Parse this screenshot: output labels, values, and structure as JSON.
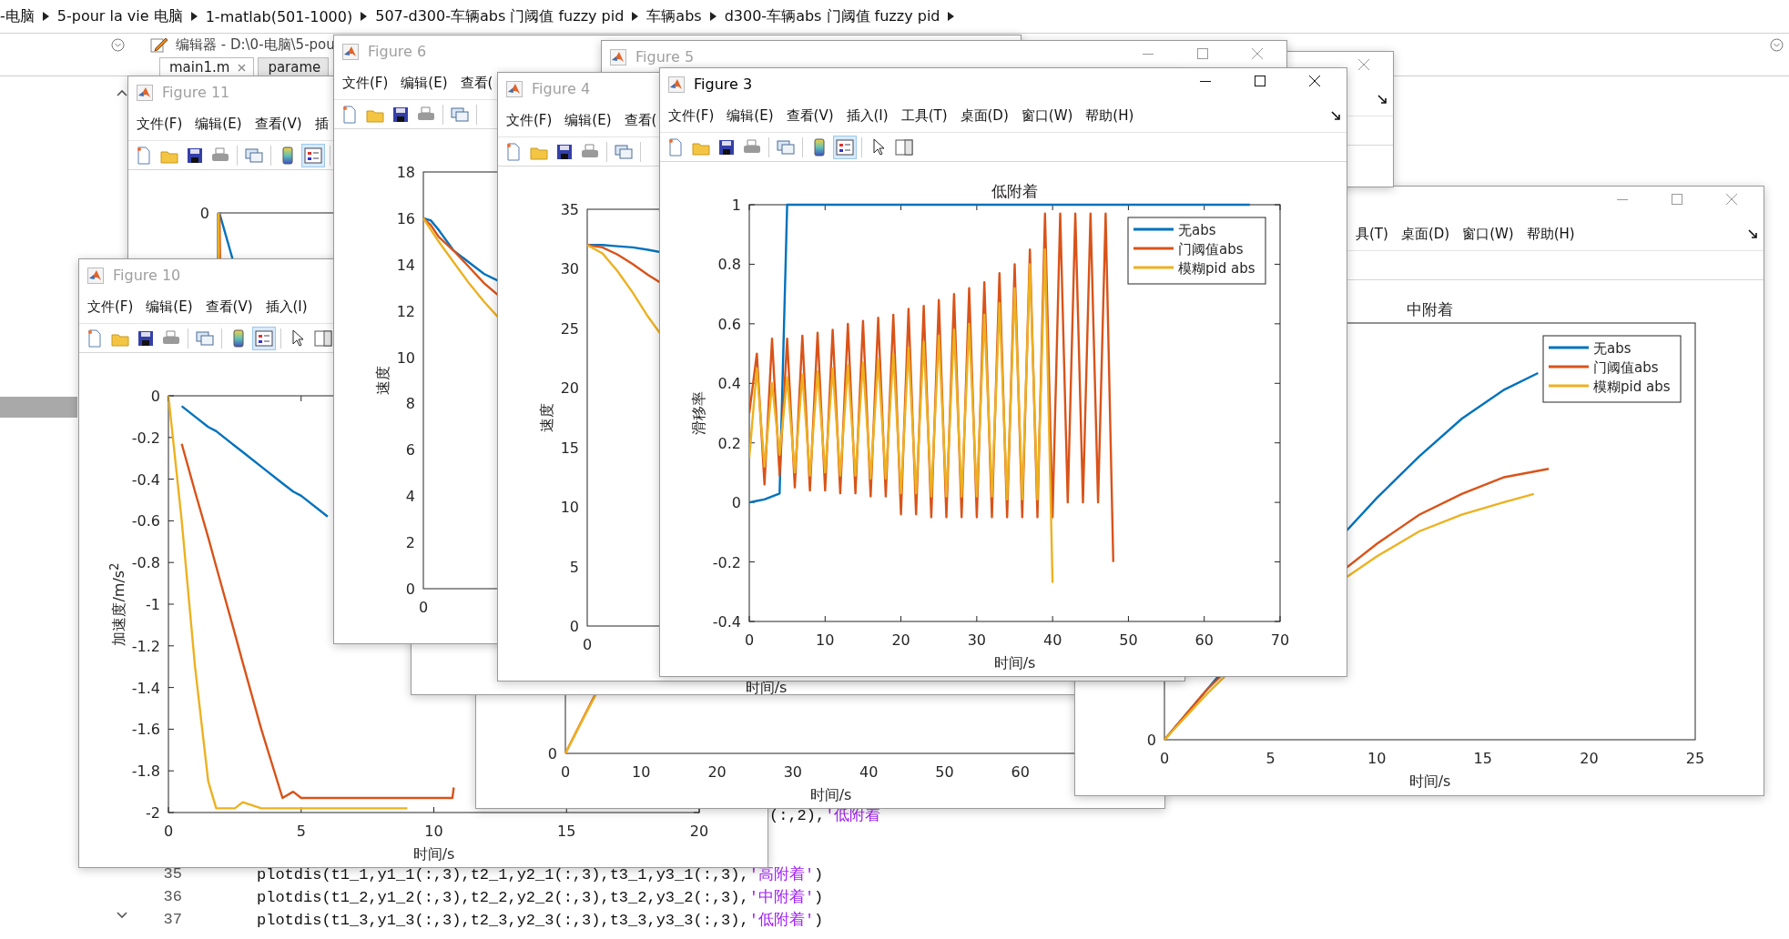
{
  "breadcrumb": [
    "-电脑",
    "5-pour la vie 电脑",
    "1-matlab(501-1000)",
    "507-d300-车辆abs 门阈值 fuzzy pid",
    "车辆abs",
    "d300-车辆abs 门阈值 fuzzy pid"
  ],
  "editor": {
    "title": "编辑器 - D:\\0-电脑\\5-pou",
    "tabs": [
      {
        "label": "main1.m",
        "selected": true
      },
      {
        "label": "parame",
        "selected": false
      }
    ],
    "fragment": {
      "code": "(:,2),",
      "string": "'低附着"
    },
    "lines": [
      {
        "number": "35",
        "code": "plotdis(t1_1,y1_1(:,3),t2_1,y2_1(:,3),t3_1,y3_1(:,3),",
        "string": "'高附着'",
        "tail": ")"
      },
      {
        "number": "36",
        "code": "plotdis(t1_2,y1_2(:,3),t2_2,y2_2(:,3),t3_2,y3_2(:,3),",
        "string": "'中附着'",
        "tail": ")"
      },
      {
        "number": "37",
        "code": "plotdis(t1_3,y1_3(:,3),t2_3,y2_3(:,3),t3_3,y3_3(:,3),",
        "string": "'低附着'",
        "tail": ")"
      }
    ]
  },
  "windows": [
    {
      "title": "Figure 11",
      "active": false,
      "menu": [
        "文件(F)",
        "编辑(E)",
        "查看(V)",
        "插"
      ],
      "toolbar": true,
      "legend_selected": true,
      "plot": {
        "kind": "descending",
        "ytick": "0"
      }
    },
    {
      "title": "Figure 10",
      "active": false,
      "menu": [
        "文件(F)",
        "编辑(E)",
        "查看(V)",
        "插入(I)"
      ],
      "toolbar": true,
      "legend_selected": true,
      "chart_data": {
        "type": "line",
        "xlabel": "时间/s",
        "ylabel": "加速度/m/s$^{2}$",
        "x": [
          0,
          0.5,
          1,
          1.5,
          1.8,
          2.5,
          2.8,
          3.5,
          4.3,
          4.7,
          5,
          6,
          8,
          9,
          10.7,
          10.75
        ],
        "series": [
          {
            "color": "#0072bd",
            "values": [
              null,
              -0.05,
              -0.1,
              -0.15,
              -0.17,
              -0.24,
              -0.27,
              -0.34,
              -0.42,
              -0.46,
              -0.48,
              -0.58,
              null,
              null,
              null,
              null
            ]
          },
          {
            "color": "#d95319",
            "values": [
              null,
              -0.23,
              -0.46,
              -0.68,
              -0.82,
              -1.14,
              -1.28,
              -1.6,
              -1.93,
              -1.9,
              -1.93,
              -1.93,
              -1.93,
              -1.93,
              -1.93,
              -1.88
            ]
          },
          {
            "color": "#edb120",
            "values": [
              0,
              -0.6,
              -1.3,
              -1.85,
              -1.98,
              -1.98,
              -1.95,
              -1.98,
              -1.98,
              -1.98,
              -1.98,
              -1.98,
              -1.98,
              -1.98,
              null,
              null
            ]
          }
        ],
        "xlim": [
          0,
          20
        ],
        "ylim": [
          -2,
          0
        ],
        "xticks": [
          0,
          5,
          10,
          15,
          20
        ],
        "yticks": [
          -2,
          -1.8,
          -1.6,
          -1.4,
          -1.2,
          -1,
          -0.8,
          -0.6,
          -0.4,
          -0.2,
          0
        ]
      }
    },
    {
      "plot": {
        "kind": "rising",
        "ytick": "0",
        "xticks": [
          "0",
          "10",
          "20",
          "30",
          "40",
          "50",
          "60"
        ],
        "xlabel": "时间/s"
      }
    },
    {
      "plot": {
        "kind": "hidden",
        "xlabel": "时间/s"
      }
    },
    {
      "title": "Figure 6",
      "active": false,
      "menu": [
        "文件(F)",
        "编辑(E)",
        "查看("
      ],
      "toolbar": true,
      "plot": {
        "kind": "falling",
        "ylabel": "速度",
        "yticks": [
          "18",
          "16",
          "14",
          "12",
          "10",
          "8",
          "6",
          "4",
          "2",
          "0"
        ],
        "xtick": "0"
      }
    },
    {
      "controls": [
        {
          "kind": "minimize"
        },
        {
          "kind": "maximize"
        },
        {
          "kind": "close"
        }
      ],
      "menu": [
        "具(T)",
        "桌面(D)",
        "窗口(W)",
        "帮助(H)"
      ],
      "dock_button": true,
      "plot": {
        "kind": "curves",
        "title": "中附着",
        "xticks": [
          "0",
          "5",
          "10",
          "15",
          "20",
          "25"
        ],
        "ytick": "0",
        "xlabel": "时间/s",
        "legend": [
          {
            "name": "无abs",
            "color": "#0072bd"
          },
          {
            "name": "门阈值abs",
            "color": "#d95319"
          },
          {
            "name": "模糊pid abs",
            "color": "#edb120"
          }
        ]
      }
    },
    {
      "controls": [
        {
          "kind": "close"
        }
      ],
      "dock_button": true
    },
    {
      "title": "Figure 5",
      "active": false,
      "controls": [
        {
          "kind": "minimize"
        },
        {
          "kind": "maximize"
        },
        {
          "kind": "close"
        }
      ]
    },
    {
      "title": "Figure 4",
      "active": false,
      "menu": [
        "文件(F)",
        "编辑(E)",
        "查看("
      ],
      "toolbar": true,
      "plot": {
        "kind": "bending",
        "ylabel": "速度",
        "yticks": [
          "35",
          "30",
          "25",
          "20",
          "15",
          "10",
          "5",
          "0"
        ],
        "xtick": "0"
      }
    },
    {
      "title": "Figure 3",
      "active": true,
      "controls": [
        {
          "kind": "minimize"
        },
        {
          "kind": "maximize"
        },
        {
          "kind": "close"
        }
      ],
      "menu": [
        "文件(F)",
        "编辑(E)",
        "查看(V)",
        "插入(I)",
        "工具(T)",
        "桌面(D)",
        "窗口(W)",
        "帮助(H)"
      ],
      "dock_button": true,
      "toolbar": true,
      "legend_selected": true,
      "chart_data": {
        "type": "line",
        "title": "低附着",
        "xlabel": "时间/s",
        "ylabel": "滑移率",
        "x": [
          0,
          1,
          2,
          3,
          4,
          5,
          6,
          7,
          8,
          9,
          10,
          11,
          12,
          13,
          14,
          15,
          16,
          17,
          18,
          19,
          20,
          21,
          22,
          23,
          24,
          25,
          26,
          27,
          28,
          29,
          30,
          31,
          32,
          33,
          34,
          35,
          36,
          37,
          38,
          39,
          40,
          41,
          42,
          43,
          44,
          45,
          46,
          47,
          48,
          50,
          55,
          60,
          66
        ],
        "series": [
          {
            "name": "无abs",
            "color": "#0072bd",
            "values": [
              0,
              0.005,
              0.01,
              0.02,
              0.03,
              1,
              1,
              1,
              1,
              1,
              1,
              1,
              1,
              1,
              1,
              1,
              1,
              1,
              1,
              1,
              1,
              1,
              1,
              1,
              1,
              1,
              1,
              1,
              1,
              1,
              1,
              1,
              1,
              1,
              1,
              1,
              1,
              1,
              1,
              1,
              1,
              1,
              1,
              1,
              1,
              1,
              1,
              1,
              1,
              1,
              1,
              1,
              1
            ]
          },
          {
            "name": "门阈值abs",
            "color": "#d95319",
            "values": [
              0.3,
              0.5,
              0.06,
              0.55,
              0.09,
              0.55,
              0.05,
              0.56,
              0.04,
              0.57,
              0.04,
              0.58,
              0.03,
              0.6,
              0.03,
              0.61,
              0.02,
              0.62,
              0.02,
              0.63,
              -0.04,
              0.65,
              -0.04,
              0.66,
              -0.05,
              0.68,
              -0.05,
              0.7,
              -0.05,
              0.72,
              -0.05,
              0.74,
              -0.05,
              0.77,
              -0.05,
              0.8,
              -0.05,
              0.85,
              -0.05,
              0.97,
              -0.05,
              0.97,
              0,
              0.97,
              0,
              0.97,
              0,
              0.97,
              -0.2,
              null,
              null,
              null,
              null
            ]
          },
          {
            "name": "模糊pid abs",
            "color": "#edb120",
            "values": [
              0.15,
              0.45,
              0.12,
              0.4,
              0.16,
              0.42,
              0.1,
              0.43,
              0.09,
              0.44,
              0.1,
              0.45,
              0.09,
              0.46,
              0.09,
              0.47,
              0.08,
              0.48,
              0.08,
              0.5,
              0.03,
              0.52,
              0.03,
              0.54,
              0.02,
              0.56,
              0.02,
              0.58,
              0.02,
              0.6,
              0.02,
              0.63,
              0.02,
              0.67,
              0.01,
              0.72,
              0.01,
              0.8,
              0.01,
              0.85,
              -0.27,
              null,
              null,
              null,
              null,
              null,
              null,
              null,
              null,
              null,
              null,
              null,
              null
            ]
          }
        ],
        "xlim": [
          0,
          70
        ],
        "ylim": [
          -0.4,
          1
        ],
        "xticks": [
          0,
          10,
          20,
          30,
          40,
          50,
          60,
          70
        ],
        "yticks": [
          -0.4,
          -0.2,
          0,
          0.2,
          0.4,
          0.6,
          0.8,
          1
        ],
        "legend": true
      }
    }
  ]
}
